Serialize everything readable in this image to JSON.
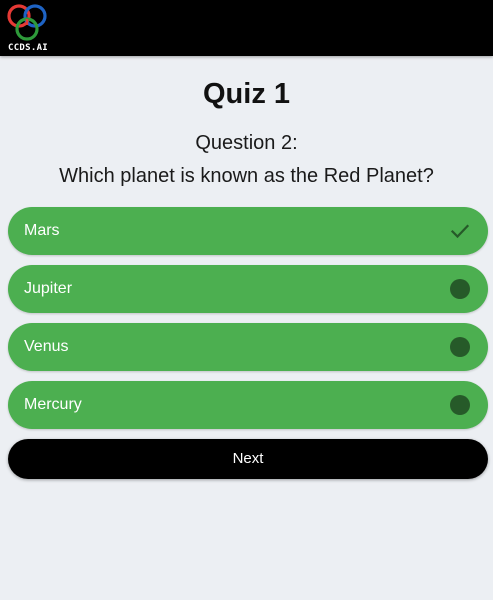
{
  "header": {
    "logo_text": "CCDS.AI"
  },
  "quiz": {
    "title": "Quiz 1",
    "question_number": "Question 2:",
    "question_text": "Which planet is known as the Red Planet?",
    "options": [
      {
        "label": "Mars",
        "selected": true,
        "indicator": "check-icon"
      },
      {
        "label": "Jupiter",
        "selected": false,
        "indicator": "radio-dot-icon"
      },
      {
        "label": "Venus",
        "selected": false,
        "indicator": "radio-dot-icon"
      },
      {
        "label": "Mercury",
        "selected": false,
        "indicator": "radio-dot-icon"
      }
    ],
    "next_label": "Next"
  },
  "colors": {
    "option_background": "#4caf50",
    "indicator_dark": "#265a29",
    "page_background": "#eceff3",
    "topbar": "#000000"
  }
}
